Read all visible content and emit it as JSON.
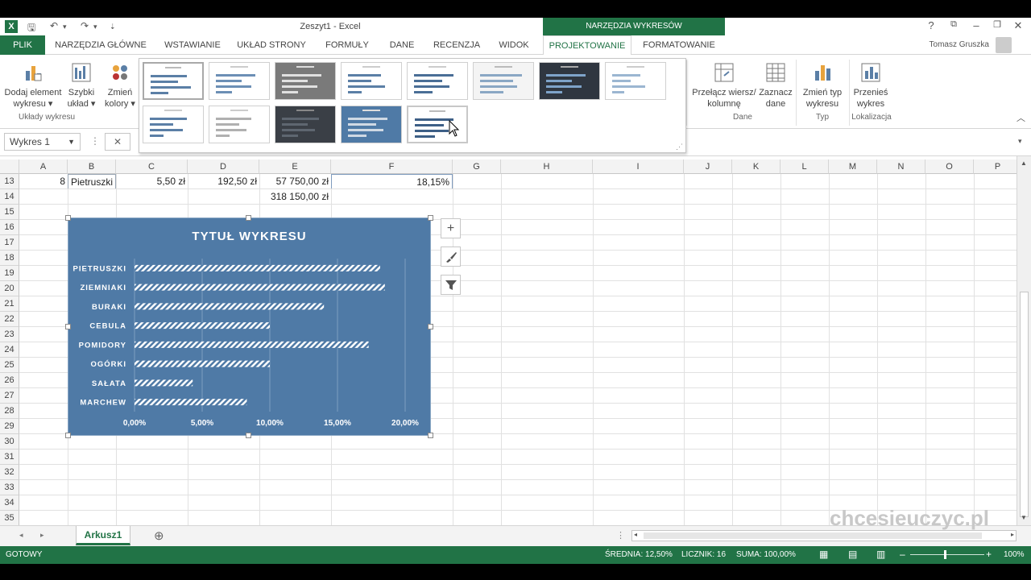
{
  "window": {
    "title": "Zeszyt1 - Excel",
    "chart_tools_header": "NARZĘDZIA WYKRESÓW",
    "user": "Tomasz Gruszka",
    "help_icon": "?"
  },
  "tabs": {
    "file": "PLIK",
    "items": [
      "NARZĘDZIA GŁÓWNE",
      "WSTAWIANIE",
      "UKŁAD STRONY",
      "FORMUŁY",
      "DANE",
      "RECENZJA",
      "WIDOK",
      "PROJEKTOWANIE",
      "FORMATOWANIE"
    ],
    "active": "PROJEKTOWANIE"
  },
  "ribbon": {
    "add_element": "Dodaj element wykresu",
    "quick_layout": "Szybki układ",
    "change_colors": "Zmień kolory",
    "group_layouts": "Układy wykresu",
    "switch_row_col": "Przełącz wiersz/ kolumnę",
    "select_data": "Zaznacz dane",
    "group_data": "Dane",
    "change_type": "Zmień typ wykresu",
    "group_type": "Typ",
    "move_chart": "Przenieś wykres",
    "group_location": "Lokalizacja"
  },
  "formula_bar": {
    "name_box": "Wykres 1",
    "cancel_icon": "✕"
  },
  "columns": [
    "A",
    "B",
    "C",
    "D",
    "E",
    "F",
    "G",
    "H",
    "I",
    "J",
    "K",
    "L",
    "M",
    "N",
    "O",
    "P"
  ],
  "rows": [
    "13",
    "14",
    "15",
    "16",
    "17",
    "18",
    "19",
    "20",
    "21",
    "22",
    "23",
    "24",
    "25",
    "26",
    "27",
    "28",
    "29",
    "30",
    "31",
    "32",
    "33",
    "34",
    "35"
  ],
  "cells": {
    "a13": "8",
    "b13": "Pietruszki",
    "c13": "5,50 zł",
    "d13": "192,50 zł",
    "e13": "57 750,00 zł",
    "f13": "18,15%",
    "e14": "318 150,00 zł"
  },
  "chart_data": {
    "type": "bar",
    "title": "TYTUŁ WYKRESU",
    "categories": [
      "PIETRUSZKI",
      "ZIEMNIAKI",
      "BURAKI",
      "CEBULA",
      "POMIDORY",
      "OGÓRKI",
      "SAŁATA",
      "MARCHEW"
    ],
    "values": [
      18.15,
      18.5,
      14.0,
      10.0,
      17.3,
      10.0,
      4.3,
      8.3
    ],
    "x_ticks": [
      "0,00%",
      "5,00%",
      "10,00%",
      "15,00%",
      "20,00%"
    ],
    "xlim": [
      0,
      20
    ],
    "unit": "%",
    "background_color": "#4f7aa6",
    "bar_pattern": "white diagonal stripes",
    "grid": true
  },
  "chart_side_buttons": {
    "elements": "+",
    "styles": "brush-icon",
    "filters": "filter-icon"
  },
  "sheet_tabs": {
    "active": "Arkusz1",
    "add": "⊕"
  },
  "status_bar": {
    "ready": "GOTOWY",
    "average": "ŚREDNIA: 12,50%",
    "count": "LICZNIK: 16",
    "sum": "SUMA: 100,00%",
    "zoom": "100%"
  },
  "watermark": "chcesieuczyc.pl",
  "colors": {
    "excel_green": "#217346",
    "chart_bg": "#4f7aa6"
  }
}
